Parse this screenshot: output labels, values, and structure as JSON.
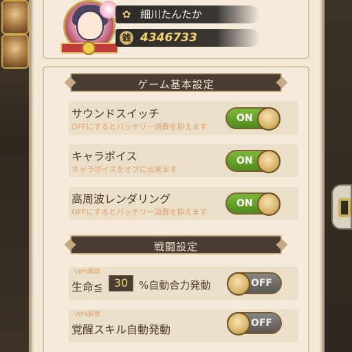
{
  "profile": {
    "player_name": "細川たんたか",
    "gold": "4346733",
    "name_icon": "flower-icon",
    "gold_icon": "coin-icon"
  },
  "sections": {
    "basic": "ゲーム基本設定",
    "battle": "戦闘設定"
  },
  "settings": [
    {
      "title": "サウンドスイッチ",
      "subtitle": "OFFにするとバッテリー消費を抑えます",
      "state": "ON"
    },
    {
      "title": "キャラボイス",
      "subtitle": "キャラボイスをオフに出来ます",
      "state": "ON"
    },
    {
      "title": "高周波レンダリング",
      "subtitle": "OFFにするとバッテリー消費を抑えます",
      "state": "ON"
    }
  ],
  "battle": {
    "auto_skill": {
      "vip": "VIP6解禁",
      "label": "生命≦",
      "value": "30",
      "suffix": "%自動合力発動",
      "state": "OFF"
    },
    "awaken": {
      "vip": "VIP4解禁",
      "label": "覚醒スキル自動発動",
      "state": "OFF"
    }
  },
  "colors": {
    "panel": "#f2e8d5",
    "header": "#4a3d34",
    "toggle_on": "#6aa52c",
    "toggle_off": "#6f6a65",
    "subtitle": "#e0a06a"
  }
}
